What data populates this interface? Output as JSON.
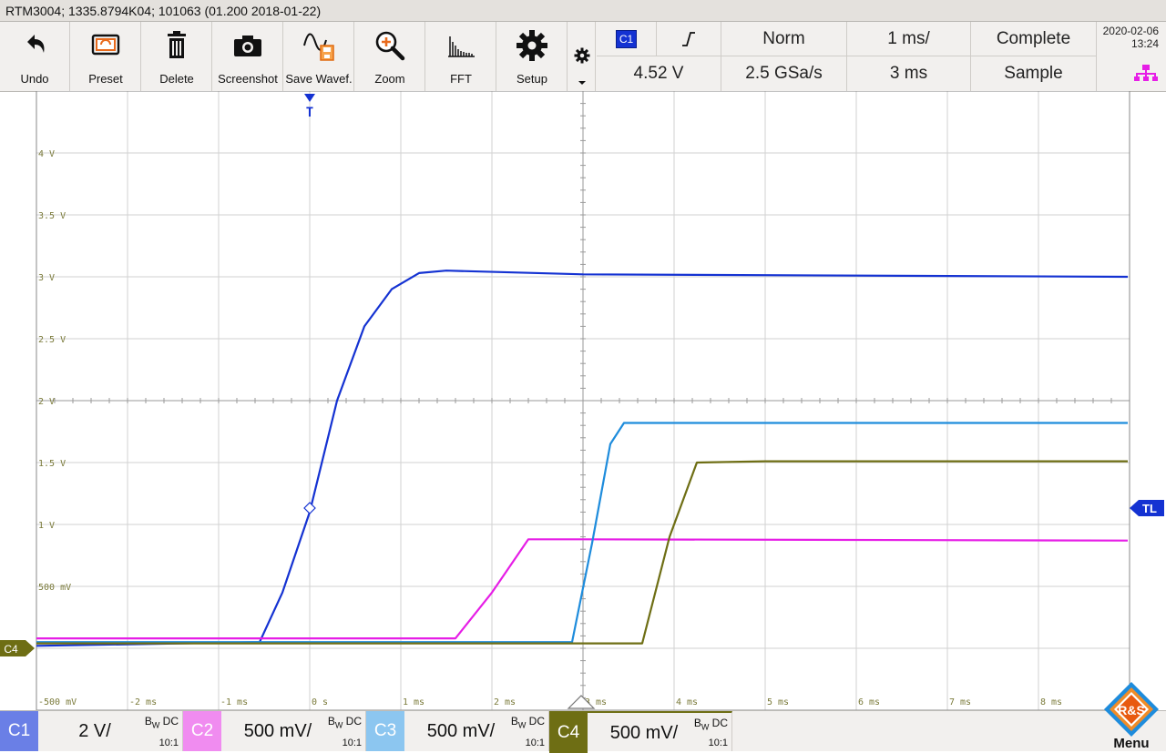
{
  "title": "RTM3004; 1335.8794K04; 101063 (01.200 2018-01-22)",
  "toolbar": {
    "buttons": [
      {
        "label": "Undo",
        "icon": "undo-icon"
      },
      {
        "label": "Preset",
        "icon": "preset-icon"
      },
      {
        "label": "Delete",
        "icon": "trash-icon"
      },
      {
        "label": "Screenshot",
        "icon": "camera-icon"
      },
      {
        "label": "Save Wavef.",
        "icon": "save-waveform-icon"
      },
      {
        "label": "Zoom",
        "icon": "zoom-icon"
      },
      {
        "label": "FFT",
        "icon": "fft-icon"
      },
      {
        "label": "Setup",
        "icon": "gear-icon"
      }
    ]
  },
  "trigger": {
    "source": "C1",
    "slope_icon": "rising-edge-icon",
    "level": "4.52 V",
    "mode": "Norm",
    "sample_rate": "2.5 GSa/s",
    "timebase": "1 ms/",
    "position": "3 ms",
    "acq_state": "Complete",
    "acq_mode": "Sample"
  },
  "datetime": {
    "date": "2020-02-06",
    "time": "13:24"
  },
  "plot": {
    "y_labels": [
      "4 V",
      "3.5 V",
      "3 V",
      "2.5 V",
      "2 V",
      "1.5 V",
      "1 V",
      "500 mV",
      "-500 mV"
    ],
    "x_labels": [
      "-2 ms",
      "-1 ms",
      "0 s",
      "1 ms",
      "2 ms",
      "3 ms",
      "4 ms",
      "5 ms",
      "6 ms",
      "7 ms",
      "8 ms"
    ],
    "trigger_marker": "T",
    "trigger_level_marker": "TL",
    "c4_ground_marker": "C4",
    "colors": {
      "c1": "#1432d2",
      "c2": "#e61ee6",
      "c3": "#1e8cdc",
      "c4": "#6e6e14"
    }
  },
  "chart_data": {
    "type": "line",
    "xlabel": "",
    "ylabel": "",
    "x_unit": "ms",
    "y_unit": "V (C1 scale)",
    "xlim": [
      -3,
      9
    ],
    "ylim": [
      -0.5,
      4.5
    ],
    "grid": true,
    "series": [
      {
        "name": "C1",
        "x": [
          -3,
          -0.55,
          -0.3,
          0,
          0.3,
          0.6,
          0.9,
          1.2,
          1.5,
          3,
          9
        ],
        "y": [
          0.02,
          0.05,
          0.45,
          1.1,
          2.0,
          2.6,
          2.9,
          3.03,
          3.05,
          3.02,
          3.0
        ]
      },
      {
        "name": "C2",
        "x": [
          -3,
          1.6,
          2.0,
          2.4,
          3,
          9
        ],
        "y": [
          0.08,
          0.08,
          0.45,
          0.88,
          0.88,
          0.87
        ]
      },
      {
        "name": "C3",
        "x": [
          -3,
          2.88,
          3.1,
          3.3,
          3.45,
          9
        ],
        "y": [
          0.05,
          0.05,
          0.85,
          1.65,
          1.82,
          1.82
        ]
      },
      {
        "name": "C4",
        "x": [
          -3,
          3.65,
          3.95,
          4.25,
          5,
          9
        ],
        "y": [
          0.04,
          0.04,
          0.9,
          1.5,
          1.51,
          1.51
        ]
      }
    ]
  },
  "channels": [
    {
      "tag": "C1",
      "scale": "2 V/",
      "bw": "B",
      "bw_sub": "W",
      "coupling": " DC",
      "ratio": "10:1"
    },
    {
      "tag": "C2",
      "scale": "500 mV/",
      "bw": "B",
      "bw_sub": "W",
      "coupling": " DC",
      "ratio": "10:1"
    },
    {
      "tag": "C3",
      "scale": "500 mV/",
      "bw": "B",
      "bw_sub": "W",
      "coupling": " DC",
      "ratio": "10:1"
    },
    {
      "tag": "C4",
      "scale": "500 mV/",
      "bw": "B",
      "bw_sub": "W",
      "coupling": " DC",
      "ratio": "10:1"
    }
  ],
  "menu": {
    "label": "Menu",
    "logo_text": "R&S"
  }
}
